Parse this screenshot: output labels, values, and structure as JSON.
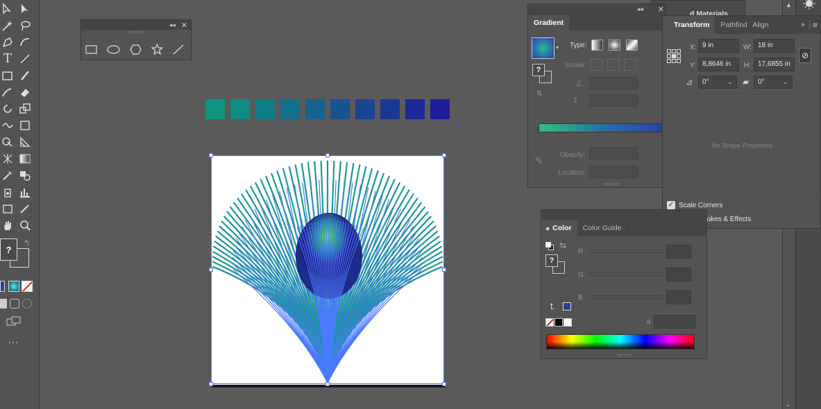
{
  "gradient_panel": {
    "title": "Gradient",
    "type_label": "Type:",
    "stroke_label": "Stroke:",
    "opacity_label": "Opacity:",
    "location_label": "Location:"
  },
  "transform_panel": {
    "tabs": [
      "Transform",
      "Pathfinder",
      "Align"
    ],
    "x_label": "X:",
    "x_value": "9 in",
    "y_label": "Y:",
    "y_value": "8,8646 in",
    "w_label": "W:",
    "w_value": "18 in",
    "h_label": "H:",
    "h_value": "17,6855 in",
    "rotate_value": "0°",
    "shear_value": "0°",
    "no_shape": "No Shape Properties",
    "scale_corners": "Scale Corners",
    "scale_strokes": "Scale Strokes & Effects"
  },
  "behind_panel_title": "d Materials",
  "color_panel": {
    "tabs": [
      "Color",
      "Color Guide"
    ],
    "r_label": "R",
    "g_label": "G",
    "b_label": "B",
    "hex_label": "#"
  },
  "question_mark": "?",
  "more_tools": "...",
  "swatches": [
    "#0f9580",
    "#0f8a84",
    "#117d87",
    "#13708b",
    "#15628c",
    "#18538f",
    "#1a4592",
    "#1b3796",
    "#1d2999",
    "#1f1c9c"
  ],
  "colors": {
    "selection": "#4a78ff",
    "gradient_start": "#2fc17a",
    "gradient_end": "#2a3fa0"
  }
}
